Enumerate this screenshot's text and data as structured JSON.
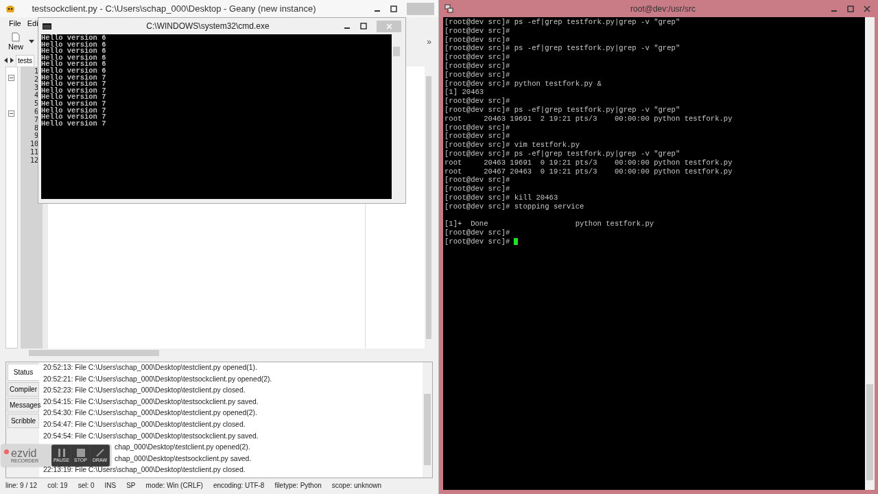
{
  "geany": {
    "title": "testsockclient.py - C:\\Users\\schap_000\\Desktop - Geany (new instance)",
    "menu": [
      "File",
      "Edi"
    ],
    "new_label": "New",
    "overflow": "»",
    "tab": "tests",
    "line_numbers": [
      "1",
      "2",
      "3",
      "4",
      "5",
      "6",
      "7",
      "8",
      "9",
      "10",
      "11",
      "12"
    ],
    "message_tabs": [
      {
        "label": "Status",
        "selected": true
      },
      {
        "label": "Compiler",
        "selected": false
      },
      {
        "label": "Messages",
        "selected": false
      },
      {
        "label": "Scribble",
        "selected": false
      }
    ],
    "log": [
      {
        "kind": "full",
        "text": "20:52:13: File C:\\Users\\schap_000\\Desktop\\testclient.py opened(1)."
      },
      {
        "kind": "full",
        "text": "20:52:21: File C:\\Users\\schap_000\\Desktop\\testsockclient.py opened(2)."
      },
      {
        "kind": "full",
        "text": "20:52:23: File C:\\Users\\schap_000\\Desktop\\testclient.py closed."
      },
      {
        "kind": "full",
        "text": "20:54:15: File C:\\Users\\schap_000\\Desktop\\testsockclient.py saved."
      },
      {
        "kind": "full",
        "text": "20:54:30: File C:\\Users\\schap_000\\Desktop\\testclient.py opened(2)."
      },
      {
        "kind": "full",
        "text": "20:54:47: File C:\\Users\\schap_000\\Desktop\\testclient.py closed."
      },
      {
        "kind": "full",
        "text": "20:54:54: File C:\\Users\\schap_000\\Desktop\\testsockclient.py saved."
      },
      {
        "kind": "partial",
        "text": "chap_000\\Desktop\\testclient.py opened(2)."
      },
      {
        "kind": "partial",
        "text": "chap_000\\Desktop\\testsockclient.py saved."
      },
      {
        "kind": "full",
        "text": "22:13:19: File C:\\Users\\schap_000\\Desktop\\testclient.py closed."
      }
    ],
    "status_bar": [
      "line: 9 / 12",
      "col: 19",
      "sel: 0",
      "INS",
      "SP",
      "mode: Win (CRLF)",
      "encoding: UTF-8",
      "filetype: Python",
      "scope: unknown"
    ]
  },
  "cmd": {
    "title": "C:\\WINDOWS\\system32\\cmd.exe",
    "lines": [
      "Hello version 6",
      "Hello version 6",
      "Hello version 6",
      "Hello version 6",
      "Hello version 6",
      "Hello version 6",
      "Hello version 7",
      "Hello version 7",
      "Hello version 7",
      "Hello version 7",
      "Hello version 7",
      "Hello version 7",
      "Hello version 7",
      "Hello version 7"
    ]
  },
  "terminal": {
    "title": "root@dev:/usr/src",
    "lines": [
      {
        "text": "[root@dev src]# ps -ef|grep testfork.py|grep -v \"grep\"",
        "cursor": false
      },
      {
        "text": "[root@dev src]#",
        "cursor": false
      },
      {
        "text": "[root@dev src]#",
        "cursor": false
      },
      {
        "text": "[root@dev src]# ps -ef|grep testfork.py|grep -v \"grep\"",
        "cursor": false
      },
      {
        "text": "[root@dev src]#",
        "cursor": false
      },
      {
        "text": "[root@dev src]#",
        "cursor": false
      },
      {
        "text": "[root@dev src]#",
        "cursor": false
      },
      {
        "text": "[root@dev src]# python testfork.py &",
        "cursor": false
      },
      {
        "text": "[1] 20463",
        "cursor": false
      },
      {
        "text": "[root@dev src]#",
        "cursor": false
      },
      {
        "text": "[root@dev src]# ps -ef|grep testfork.py|grep -v \"grep\"",
        "cursor": false
      },
      {
        "text": "root     20463 19691  2 19:21 pts/3    00:00:00 python testfork.py",
        "cursor": false
      },
      {
        "text": "[root@dev src]#",
        "cursor": false
      },
      {
        "text": "[root@dev src]#",
        "cursor": false
      },
      {
        "text": "[root@dev src]# vim testfork.py",
        "cursor": false
      },
      {
        "text": "[root@dev src]# ps -ef|grep testfork.py|grep -v \"grep\"",
        "cursor": false
      },
      {
        "text": "root     20463 19691  0 19:21 pts/3    00:00:00 python testfork.py",
        "cursor": false
      },
      {
        "text": "root     20467 20463  0 19:21 pts/3    00:00:00 python testfork.py",
        "cursor": false
      },
      {
        "text": "[root@dev src]#",
        "cursor": false
      },
      {
        "text": "[root@dev src]#",
        "cursor": false
      },
      {
        "text": "[root@dev src]# kill 20463",
        "cursor": false
      },
      {
        "text": "[root@dev src]# stopping service",
        "cursor": false
      },
      {
        "cursor": false
      },
      {
        "text": "[1]+  Done                    python testfork.py",
        "cursor": false
      },
      {
        "text": "[root@dev src]#",
        "cursor": false
      },
      {
        "text": "[root@dev src]#",
        "cursor": true
      }
    ]
  },
  "recorder": {
    "logo": "ezvid",
    "subtitle": "RECORDER",
    "buttons": [
      "PAUSE",
      "STOP",
      "DRAW"
    ]
  }
}
